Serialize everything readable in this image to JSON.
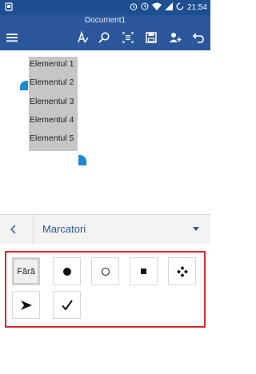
{
  "status_bar": {
    "time": "21:54",
    "icons": [
      "notification-icon",
      "alarm-icon",
      "wifi-icon",
      "signal-icon",
      "sync-icon"
    ]
  },
  "title_bar": {
    "document_title": "Document1",
    "icons": [
      "menu-icon",
      "format-icon",
      "search-icon",
      "read-mode-icon",
      "save-icon",
      "share-icon",
      "undo-icon"
    ]
  },
  "document": {
    "list_items": [
      "Elementul 1",
      "Elementul 2",
      "Elementul 3",
      "Elementul 4",
      "Elementul 5"
    ]
  },
  "panel": {
    "title": "Marcatori",
    "back_icon": "chevron-left-icon",
    "dropdown_icon": "caret-down-icon"
  },
  "bullet_gallery": {
    "none_label": "Fără",
    "options": [
      "none",
      "filled-circle",
      "hollow-circle",
      "square",
      "diamond-cluster",
      "arrowhead",
      "checkmark"
    ],
    "selected": "none"
  },
  "colors": {
    "title_bar": "#2b579a",
    "status_bar": "#1d4f91",
    "selection": "#c6c6c6",
    "handle": "#1a8bd1",
    "highlight_border": "#d9262c"
  }
}
